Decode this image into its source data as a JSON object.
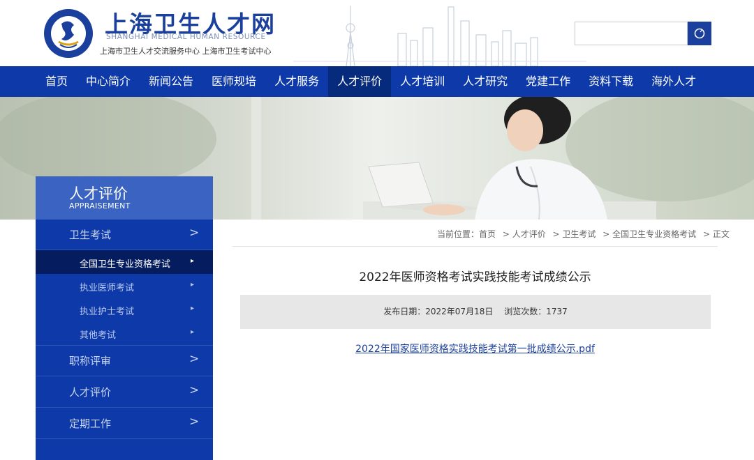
{
  "site": {
    "title_cn": "上海卫生人才网",
    "title_en": "SHANGHAI MEDICAL HUMAN RESOURCE",
    "subtitle": "上海市卫生人才交流服务中心  上海市卫生考试中心",
    "brand_color": "#0d3aa8"
  },
  "search": {
    "placeholder": "",
    "value": ""
  },
  "nav": {
    "items": [
      {
        "label": "首页"
      },
      {
        "label": "中心简介"
      },
      {
        "label": "新闻公告"
      },
      {
        "label": "医师规培"
      },
      {
        "label": "人才服务"
      },
      {
        "label": "人才评价"
      },
      {
        "label": "人才培训"
      },
      {
        "label": "人才研究"
      },
      {
        "label": "党建工作"
      },
      {
        "label": "资料下载"
      },
      {
        "label": "海外人才"
      }
    ],
    "active": "人才评价"
  },
  "sidebar": {
    "title_cn": "人才评价",
    "title_en": "APPRAISEMENT",
    "categories": [
      {
        "label": "卫生考试",
        "chevron": ">"
      },
      {
        "label": "职称评审",
        "chevron": ">"
      },
      {
        "label": "人才评价",
        "chevron": ">"
      },
      {
        "label": "定期工作",
        "chevron": ">"
      }
    ],
    "sub_items": [
      {
        "label": "全国卫生专业资格考试",
        "marker": "▸"
      },
      {
        "label": "执业医师考试",
        "marker": "▸"
      },
      {
        "label": "执业护士考试",
        "marker": "▸"
      },
      {
        "label": "其他考试",
        "marker": "▸"
      }
    ]
  },
  "breadcrumb": {
    "prefix": "当前位置：首页",
    "items": [
      "> 人才评价",
      "> 卫生考试",
      "> 全国卫生专业资格考试",
      "> 正文"
    ]
  },
  "article": {
    "title": "2022年医师资格考试实践技能考试成绩公示",
    "publish_label": "发布日期：2022年07月18日",
    "views_label": "浏览次数：1737",
    "attachment": "2022年国家医师资格实践技能考试第一批成绩公示.pdf"
  }
}
